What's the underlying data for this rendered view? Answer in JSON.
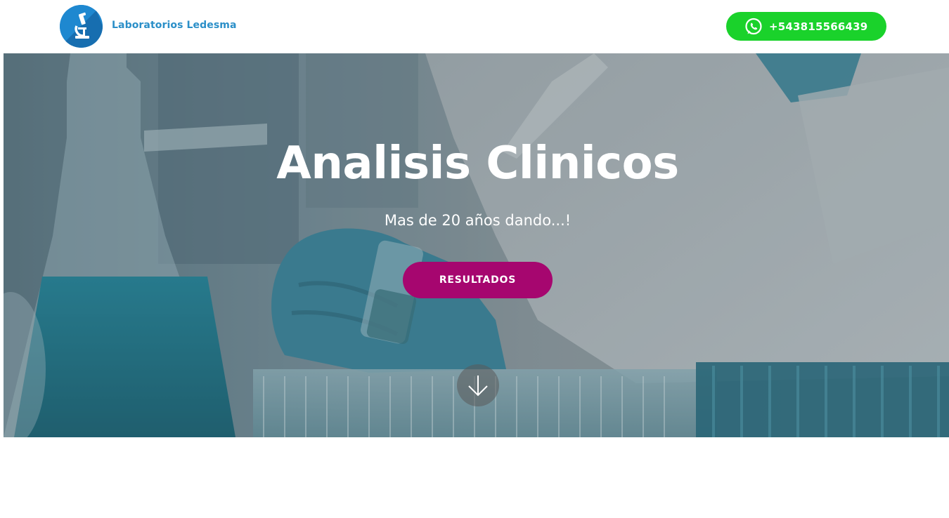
{
  "header": {
    "brand_name": "Laboratorios Ledesma",
    "logo_icon": "microscope-icon",
    "whatsapp": {
      "icon": "whatsapp-icon",
      "number": "+543815566439",
      "color": "#1ad22b"
    }
  },
  "hero": {
    "title": "Analisis Clinicos",
    "subtitle": "Mas de 20 años dando...!",
    "cta_label": "RESULTADOS",
    "cta_color": "#a6066f",
    "scroll_icon": "arrow-down-icon"
  }
}
